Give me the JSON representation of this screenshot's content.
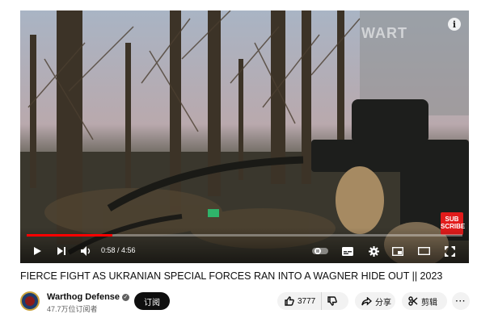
{
  "video": {
    "watermark": "WART",
    "subscribe_badge": "SUB SCRIBE",
    "time_current": "0:58",
    "time_separator": " / ",
    "time_total": "4:56",
    "progress_played": 0.196,
    "progress_buffered": 0.196,
    "info_glyph": "i"
  },
  "title": "FIERCE FIGHT AS UKRANIAN SPECIAL FORCES RAN INTO A WAGNER HIDE OUT || 2023",
  "channel": {
    "name": "Warthog Defense",
    "verified_glyph": "✓",
    "subscribers": "47.7万位订阅者",
    "subscribe_label": "订阅"
  },
  "actions": {
    "like_count": "3777",
    "share_label": "分享",
    "clip_label": "剪辑",
    "more_glyph": "···"
  },
  "colors": {
    "progress": "#ff0000",
    "subscribe_button": "#0f0f0f",
    "subscribe_badge": "#e21b1b"
  },
  "icons": [
    "play-icon",
    "next-icon",
    "volume-icon",
    "pause-toggle-icon",
    "subtitles-icon",
    "settings-icon",
    "miniplayer-icon",
    "theater-icon",
    "fullscreen-icon",
    "like-icon",
    "dislike-icon",
    "share-icon",
    "scissors-icon",
    "more-icon",
    "info-icon",
    "verified-icon"
  ]
}
